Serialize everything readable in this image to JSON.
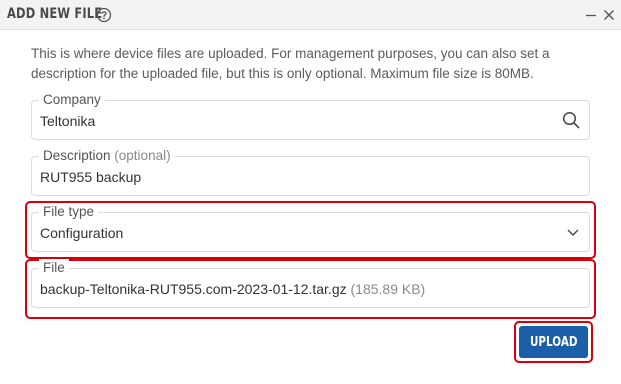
{
  "dialog": {
    "title": "ADD NEW FILE",
    "help_icon": "help-circle-icon",
    "minimize_icon": "minimize-icon",
    "close_icon": "close-icon",
    "description": "This is where device files are uploaded. For management purposes, you can also set a description for the uploaded file, but this is only optional. Maximum file size is 80MB."
  },
  "form": {
    "company": {
      "label": "Company",
      "value": "Teltonika",
      "icon": "search-icon"
    },
    "description": {
      "label": "Description",
      "label_optional": "(optional)",
      "value": "RUT955 backup"
    },
    "file_type": {
      "label": "File type",
      "value": "Configuration",
      "icon": "chevron-down-icon"
    },
    "file": {
      "label": "File",
      "value": "backup-Teltonika-RUT955.com-2023-01-12.tar.gz",
      "size": "(185.89 KB)"
    }
  },
  "actions": {
    "upload_label": "UPLOAD"
  },
  "colors": {
    "accent": "#1a5fa8",
    "highlight": "#d9000d",
    "header_bg": "#f3f3f3"
  }
}
